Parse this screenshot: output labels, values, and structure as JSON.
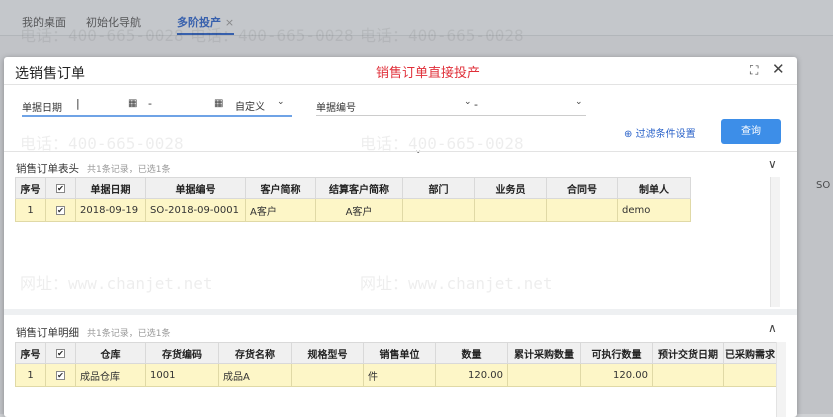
{
  "tabs": [
    {
      "label": "我的桌面"
    },
    {
      "label": "初始化导航"
    },
    {
      "label": "多阶投产"
    }
  ],
  "background_text": "SO",
  "modal": {
    "title": "选销售订单",
    "annotation": "销售订单直接投产",
    "filters": {
      "date_label": "单据日期",
      "date_sep": "-",
      "date_range": "自定义",
      "code_label": "单据编号",
      "code_sep": "-"
    },
    "filter_settings": "过滤条件设置",
    "query": "查询",
    "header_section": {
      "title": "销售订单表头",
      "summary": "共1条记录，已选1条",
      "columns": [
        "序号",
        "",
        "单据日期",
        "单据编号",
        "客户简称",
        "结算客户简称",
        "部门",
        "业务员",
        "合同号",
        "制单人"
      ],
      "rows": [
        {
          "no": "1",
          "checked": true,
          "date": "2018-09-19",
          "code": "SO-2018-09-0001",
          "customer": "A客户",
          "settle_customer": "A客户",
          "dept": "",
          "salesman": "",
          "contract": "",
          "maker": "demo"
        }
      ]
    },
    "detail_section": {
      "title": "销售订单明细",
      "summary": "共1条记录，已选1条",
      "columns": [
        "序号",
        "",
        "仓库",
        "存货编码",
        "存货名称",
        "规格型号",
        "销售单位",
        "数量",
        "累计采购数量",
        "可执行数量",
        "预计交货日期",
        "已采购需求"
      ],
      "rows": [
        {
          "no": "1",
          "checked": true,
          "warehouse": "成品仓库",
          "inv_code": "1001",
          "inv_name": "成品A",
          "spec": "",
          "unit": "件",
          "qty": "120.00",
          "cum_purchase": "",
          "exec_qty": "120.00",
          "delivery_date": "",
          "purchased": ""
        }
      ]
    }
  },
  "watermarks": {
    "phone": "电话：400-665-0028",
    "site": "网址：www.chanjet.net"
  }
}
